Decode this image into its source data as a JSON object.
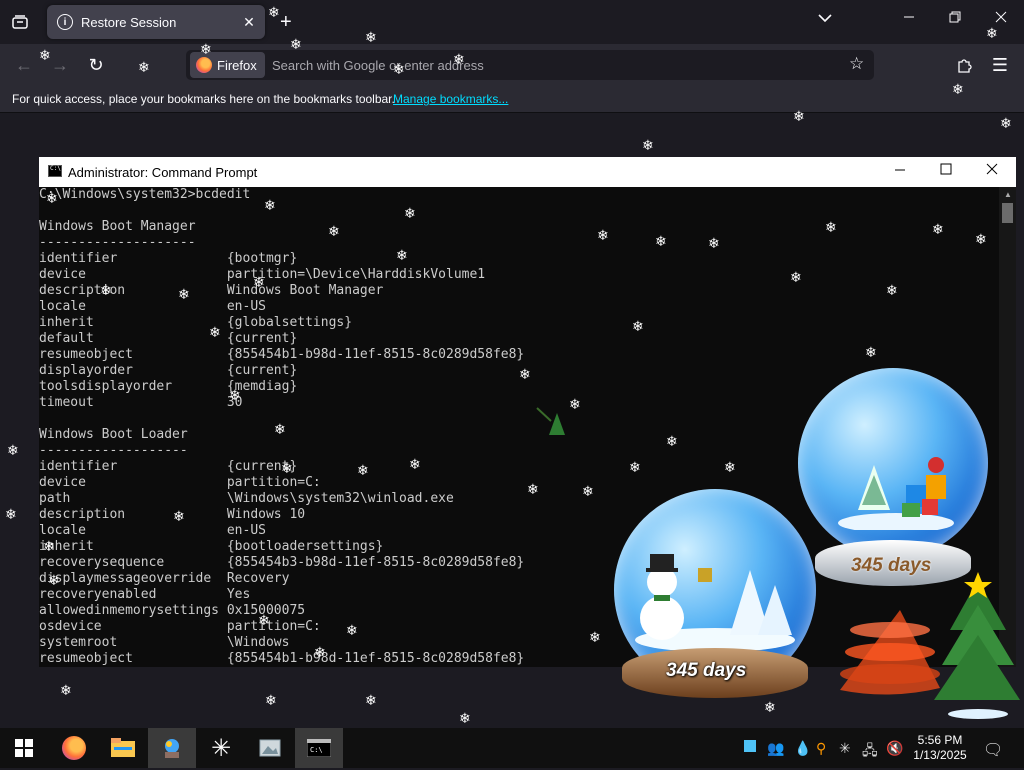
{
  "browser": {
    "tab_title": "Restore Session",
    "identity_label": "Firefox",
    "url_placeholder": "Search with Google or enter address",
    "bookmarks_message": "For quick access, place your bookmarks here on the bookmarks toolbar.",
    "bookmarks_link": "Manage bookmarks...",
    "icons": {
      "tab_list": "tab-list-icon",
      "tab_info": "info-icon",
      "tab_close": "close-icon",
      "new_tab": "plus-icon",
      "back": "arrow-left-icon",
      "forward": "arrow-right-icon",
      "reload": "reload-icon",
      "bookmark_star": "star-icon",
      "extensions": "puzzle-icon",
      "menu": "hamburger-icon"
    }
  },
  "cmd": {
    "title": "Administrator: Command Prompt",
    "lines": [
      "C:\\Windows\\system32>bcdedit",
      "",
      "Windows Boot Manager",
      "--------------------",
      "identifier              {bootmgr}",
      "device                  partition=\\Device\\HarddiskVolume1",
      "description             Windows Boot Manager",
      "locale                  en-US",
      "inherit                 {globalsettings}",
      "default                 {current}",
      "resumeobject            {855454b1-b98d-11ef-8515-8c0289d58fe8}",
      "displayorder            {current}",
      "toolsdisplayorder       {memdiag}",
      "timeout                 30",
      "",
      "Windows Boot Loader",
      "-------------------",
      "identifier              {current}",
      "device                  partition=C:",
      "path                    \\Windows\\system32\\winload.exe",
      "description             Windows 10",
      "locale                  en-US",
      "inherit                 {bootloadersettings}",
      "recoverysequence        {855454b3-b98d-11ef-8515-8c0289d58fe8}",
      "displaymessageoverride  Recovery",
      "recoveryenabled         Yes",
      "allowedinmemorysettings 0x15000075",
      "osdevice                partition=C:",
      "systemroot              \\Windows",
      "resumeobject            {855454b1-b98d-11ef-8515-8c0289d58fe8}"
    ]
  },
  "desktop": {
    "globe_left_label": "345 days",
    "globe_right_label": "345 days"
  },
  "taskbar": {
    "time": "5:56 PM",
    "date": "1/13/2025",
    "apps": [
      "start-icon",
      "firefox-icon",
      "file-explorer-icon",
      "desktop-toy-icon",
      "snowflake-app-icon",
      "photos-icon",
      "command-prompt-icon"
    ],
    "tray": [
      "app-square-icon",
      "people-icon",
      "water-drop-icon",
      "search-magnifier-icon",
      "snowflake-tray-icon",
      "network-icon",
      "volume-muted-icon",
      "notifications-icon"
    ]
  },
  "colors": {
    "browser_bg": "#1c1b22",
    "toolbar_bg": "#2b2a33",
    "link": "#00ddff",
    "cmd_bg": "#0c0c0c",
    "cmd_text": "#cccccc",
    "taskbar_bg": "#101010"
  }
}
